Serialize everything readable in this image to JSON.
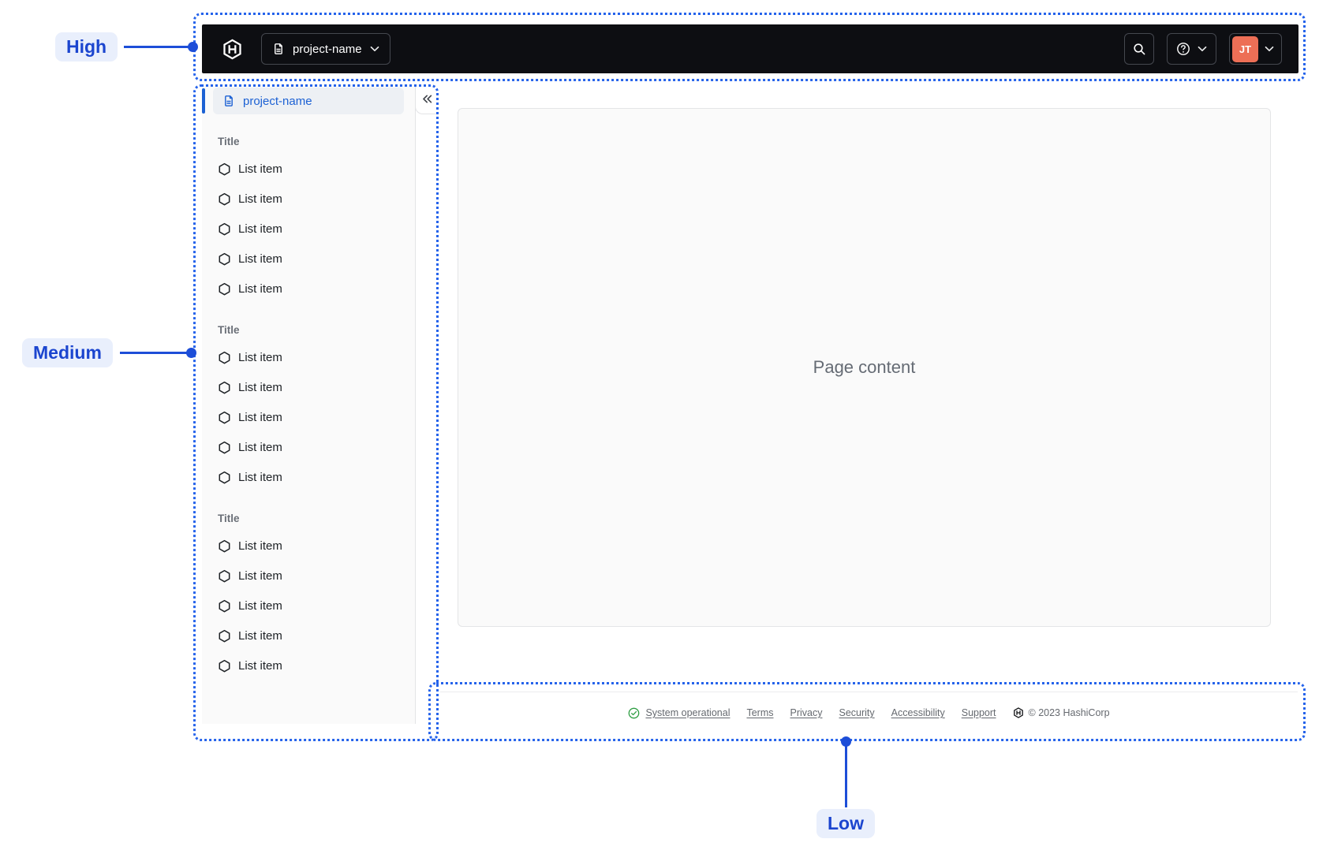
{
  "annotations": {
    "high_label": "High",
    "medium_label": "Medium",
    "low_label": "Low",
    "outline_color": "#2563eb",
    "label_color": "#1b45cf",
    "label_bg": "#e9effc"
  },
  "navbar": {
    "bg_color": "#0d0e12",
    "logo_icon": "hashicorp-logo",
    "project_switcher": {
      "icon": "file-text",
      "label": "project-name",
      "chevron": "chevron-down"
    },
    "search_icon": "search",
    "help_icon": "help-circle",
    "user_menu": {
      "initials": "JT",
      "avatar_color": "#ed6f56",
      "chevron": "chevron-down"
    }
  },
  "sidebar": {
    "active_item": {
      "icon": "file-text",
      "label": "project-name"
    },
    "collapse_icon": "chevron-double-left",
    "accent_color": "#1c61d4",
    "sections": [
      {
        "title": "Title",
        "items": [
          "List item",
          "List item",
          "List item",
          "List item",
          "List item"
        ]
      },
      {
        "title": "Title",
        "items": [
          "List item",
          "List item",
          "List item",
          "List item",
          "List item"
        ]
      },
      {
        "title": "Title",
        "items": [
          "List item",
          "List item",
          "List item",
          "List item",
          "List item"
        ]
      }
    ]
  },
  "main": {
    "placeholder": "Page content"
  },
  "footer": {
    "status": {
      "icon": "check-circle",
      "label": "System operational",
      "icon_color": "#2f9e44"
    },
    "links": [
      "Terms",
      "Privacy",
      "Security",
      "Accessibility",
      "Support"
    ],
    "logo_icon": "hashicorp-logo",
    "copyright": "© 2023 HashiCorp"
  }
}
